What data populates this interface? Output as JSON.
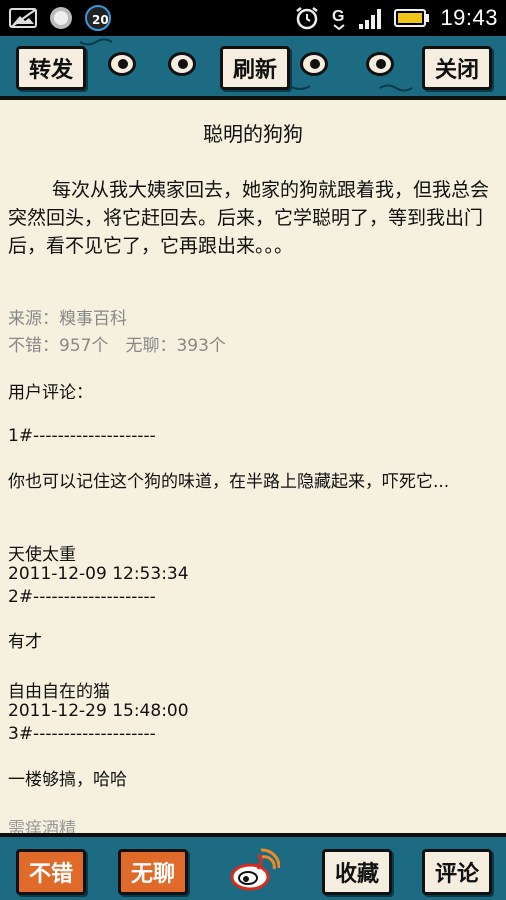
{
  "status_bar": {
    "notification_count": "20",
    "time": "19:43",
    "icons": [
      "image-icon",
      "record-icon",
      "alarm-icon",
      "g-icon",
      "signal-icon",
      "battery-icon"
    ]
  },
  "toolbar": {
    "forward_label": "转发",
    "refresh_label": "刷新",
    "close_label": "关闭"
  },
  "article": {
    "title": "聪明的狗狗",
    "body": "每次从我大姨家回去，她家的狗就跟着我，但我总会突然回头，将它赶回去。后来，它学聪明了，等到我出门后，看不见它了，它再跟出来。。。",
    "source": "来源：糗事百科",
    "stats": "不错：957个　无聊：393个"
  },
  "comments": {
    "heading": "用户评论：",
    "items": [
      {
        "number": "1#--------------------",
        "text": "你也可以记住这个狗的味道，在半路上隐藏起来，吓死它...",
        "author": "天使太重",
        "time": "2011-12-09 12:53:34"
      },
      {
        "number": "2#--------------------",
        "text": "有才",
        "author": "自由自在的猫",
        "time": "2011-12-29 15:48:00"
      },
      {
        "number": "3#--------------------",
        "text": "一楼够搞，哈哈",
        "author": "需痒酒精",
        "time": ""
      }
    ]
  },
  "bottom_bar": {
    "good_label": "不错",
    "boring_label": "无聊",
    "favorite_label": "收藏",
    "comment_label": "评论"
  },
  "colors": {
    "toolbar_bg": "#1d6a83",
    "page_bg": "#f6f1de",
    "accent_orange": "#e06a2a"
  }
}
